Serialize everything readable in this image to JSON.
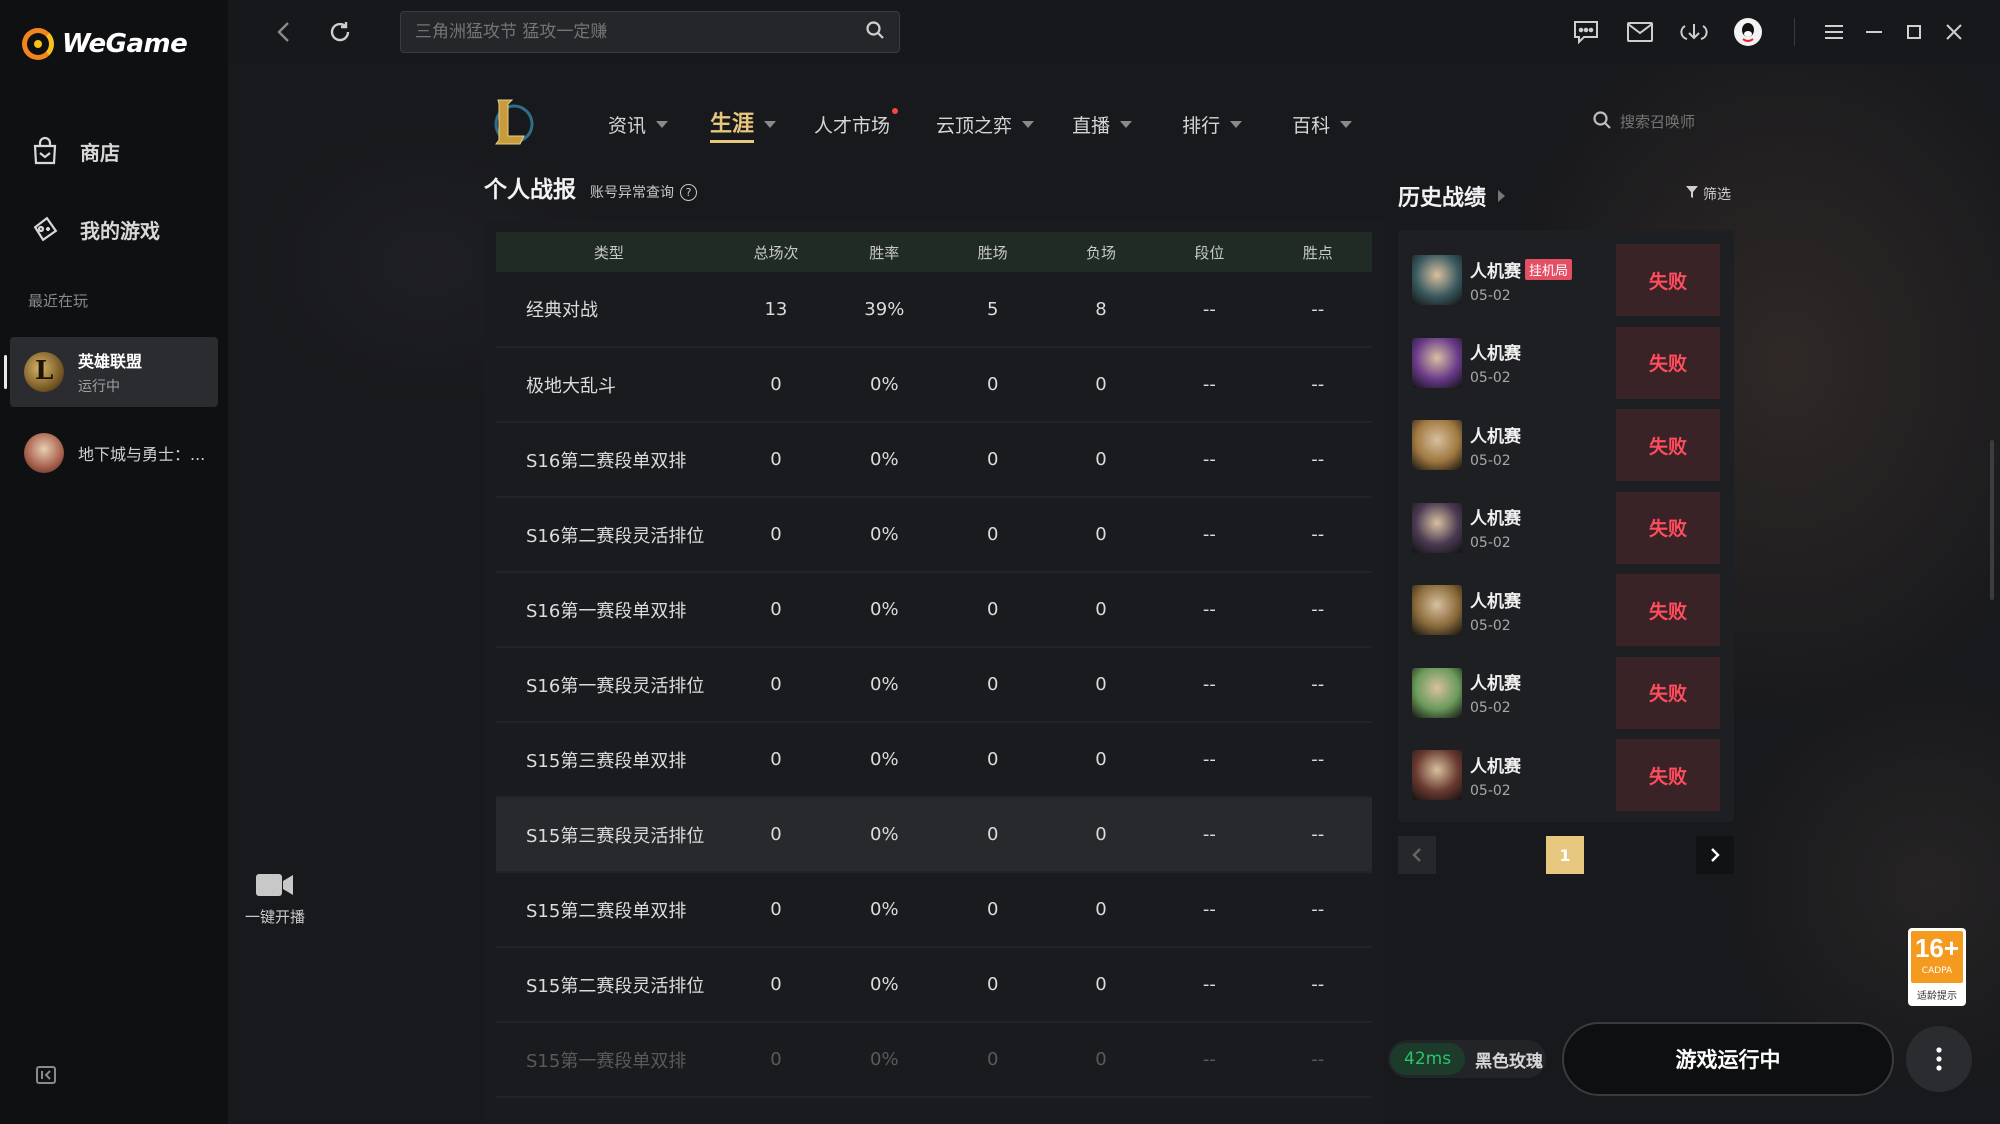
{
  "app": {
    "brand": "WeGame",
    "accent": "#e7c77d",
    "loss_color": "#ff4d5e"
  },
  "sidebar": {
    "store": "商店",
    "my_games": "我的游戏",
    "recent_label": "最近在玩",
    "recent": [
      {
        "name": "英雄联盟",
        "status": "运行中"
      },
      {
        "name": "地下城与勇士：..."
      }
    ],
    "live_label": "一键开播"
  },
  "topbar": {
    "search_placeholder": "三角洲猛攻节 猛攻一定赚"
  },
  "game_nav": {
    "items": [
      {
        "label": "资讯"
      },
      {
        "label": "生涯"
      },
      {
        "label": "人才市场"
      },
      {
        "label": "云顶之弈"
      },
      {
        "label": "直播"
      },
      {
        "label": "排行"
      },
      {
        "label": "百科"
      }
    ],
    "summoner_search_placeholder": "搜索召唤师"
  },
  "stats": {
    "title": "个人战报",
    "account_check": "账号异常查询",
    "headers": [
      "类型",
      "总场次",
      "胜率",
      "胜场",
      "负场",
      "段位",
      "胜点"
    ],
    "rows": [
      [
        "经典对战",
        "13",
        "39%",
        "5",
        "8",
        "--",
        "--"
      ],
      [
        "极地大乱斗",
        "0",
        "0%",
        "0",
        "0",
        "--",
        "--"
      ],
      [
        "S16第二赛段单双排",
        "0",
        "0%",
        "0",
        "0",
        "--",
        "--"
      ],
      [
        "S16第二赛段灵活排位",
        "0",
        "0%",
        "0",
        "0",
        "--",
        "--"
      ],
      [
        "S16第一赛段单双排",
        "0",
        "0%",
        "0",
        "0",
        "--",
        "--"
      ],
      [
        "S16第一赛段灵活排位",
        "0",
        "0%",
        "0",
        "0",
        "--",
        "--"
      ],
      [
        "S15第三赛段单双排",
        "0",
        "0%",
        "0",
        "0",
        "--",
        "--"
      ],
      [
        "S15第三赛段灵活排位",
        "0",
        "0%",
        "0",
        "0",
        "--",
        "--"
      ],
      [
        "S15第二赛段单双排",
        "0",
        "0%",
        "0",
        "0",
        "--",
        "--"
      ],
      [
        "S15第二赛段灵活排位",
        "0",
        "0%",
        "0",
        "0",
        "--",
        "--"
      ],
      [
        "S15第一赛段单双排",
        "0",
        "0%",
        "0",
        "0",
        "--",
        "--"
      ]
    ]
  },
  "history": {
    "title": "历史战绩",
    "filter": "筛选",
    "matches": [
      {
        "mode": "人机赛",
        "tag": "挂机局",
        "date": "05-02",
        "result": "失败",
        "champ_color": "#3a5a60"
      },
      {
        "mode": "人机赛",
        "date": "05-02",
        "result": "失败",
        "champ_color": "#6a3a8a"
      },
      {
        "mode": "人机赛",
        "date": "05-02",
        "result": "失败",
        "champ_color": "#a07840"
      },
      {
        "mode": "人机赛",
        "date": "05-02",
        "result": "失败",
        "champ_color": "#4a3a52"
      },
      {
        "mode": "人机赛",
        "date": "05-02",
        "result": "失败",
        "champ_color": "#8a6a3a"
      },
      {
        "mode": "人机赛",
        "date": "05-02",
        "result": "失败",
        "champ_color": "#6a9a5a"
      },
      {
        "mode": "人机赛",
        "date": "05-02",
        "result": "失败",
        "champ_color": "#6a3a30"
      }
    ],
    "page": "1"
  },
  "bottom": {
    "ping": "42ms",
    "server": "黑色玫瑰",
    "play_button": "游戏运行中"
  },
  "age_badge": {
    "age": "16+",
    "org": "CADPA",
    "tip": "适龄提示"
  }
}
